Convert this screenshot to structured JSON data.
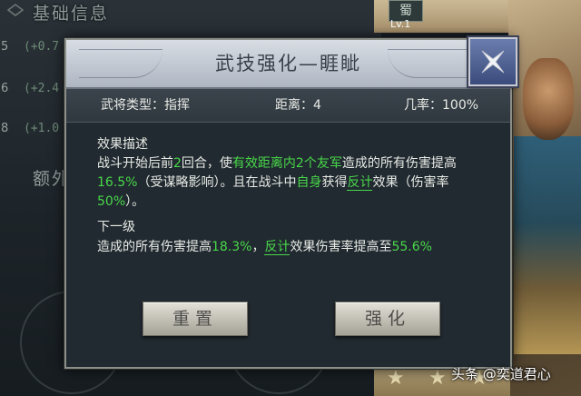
{
  "background": {
    "section_title": "基础信息",
    "section_title_2": "额外",
    "rows": [
      {
        "num": "5",
        "stat": "(+0.7"
      },
      {
        "num": "6",
        "stat": "(+2.4"
      },
      {
        "num": "8",
        "stat": "(+1.0"
      }
    ],
    "character_label": "蜀",
    "level_label": "Lv.1"
  },
  "dialog": {
    "title": "武技强化—睚眦",
    "info": {
      "general_type": "武将类型：指挥",
      "range": "距离：4",
      "chance": "几率：100%"
    },
    "effect_heading": "效果描述",
    "effect_text": {
      "p1": "战斗开始后前",
      "p2": "2",
      "p3": "回合，使",
      "p4": "有效距离内2个友军",
      "p5": "造成的所有伤害提高",
      "p6": "16.5%",
      "p7": "（受谋略影响）。且在战斗中",
      "p8": "自身",
      "p9": "获得",
      "p10": "反计",
      "p11": "效果（伤害率",
      "p12": "50%",
      "p13": "）。"
    },
    "next_heading": "下一级",
    "next_text": {
      "p1": "造成的所有伤害提高",
      "p2": "18.3%",
      "p3": "，",
      "p4": "反计",
      "p5": "效果伤害率提高至",
      "p6": "55.6%"
    },
    "reset_button": "重置",
    "upgrade_button": "强化",
    "close_icon": "close-x-icon"
  },
  "watermark": "头条 @奕道君心",
  "colors": {
    "highlight": "#49d84a",
    "dialog_bg": "#212a30",
    "header_bg": "#c3cad4"
  }
}
